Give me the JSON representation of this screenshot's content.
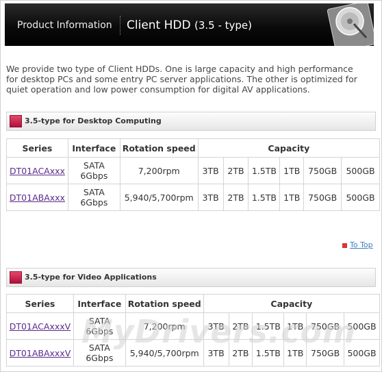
{
  "banner": {
    "section": "Product Information",
    "title": "Client HDD",
    "title_sub": "(3.5 - type)"
  },
  "intro": "We provide two type of Client HDDs.  One is large capacity and high performance for desktop PCs and some entry PC server applications.  The other is optimized for quiet operation and low power consumption  for digital AV applications.",
  "sections": [
    {
      "label": "3.5-type for Desktop Computing",
      "headers": {
        "series": "Series",
        "interface": "Interface",
        "rotation": "Rotation speed",
        "capacity": "Capacity"
      },
      "rows": [
        {
          "series": "DT01ACAxxx",
          "iface1": "SATA",
          "iface2": "6Gbps",
          "rpm": "7,200rpm",
          "caps": [
            "3TB",
            "2TB",
            "1.5TB",
            "1TB",
            "750GB",
            "500GB"
          ]
        },
        {
          "series": "DT01ABAxxx",
          "iface1": "SATA",
          "iface2": "6Gbps",
          "rpm": "5,940/5,700rpm",
          "caps": [
            "3TB",
            "2TB",
            "1.5TB",
            "1TB",
            "750GB",
            "500GB"
          ]
        }
      ]
    },
    {
      "label": "3.5-type for Video Applications",
      "headers": {
        "series": "Series",
        "interface": "Interface",
        "rotation": "Rotation speed",
        "capacity": "Capacity"
      },
      "rows": [
        {
          "series": "DT01ACAxxxV",
          "iface1": "SATA",
          "iface2": "6Gbps",
          "rpm": "7,200rpm",
          "caps": [
            "3TB",
            "2TB",
            "1.5TB",
            "1TB",
            "750GB",
            "500GB"
          ]
        },
        {
          "series": "DT01ABAxxxV",
          "iface1": "SATA",
          "iface2": "6Gbps",
          "rpm": "5,940/5,700rpm",
          "caps": [
            "3TB",
            "2TB",
            "1.5TB",
            "1TB",
            "750GB",
            "500GB"
          ]
        }
      ]
    }
  ],
  "to_top": "To Top",
  "watermark": "MyDrivers.com"
}
